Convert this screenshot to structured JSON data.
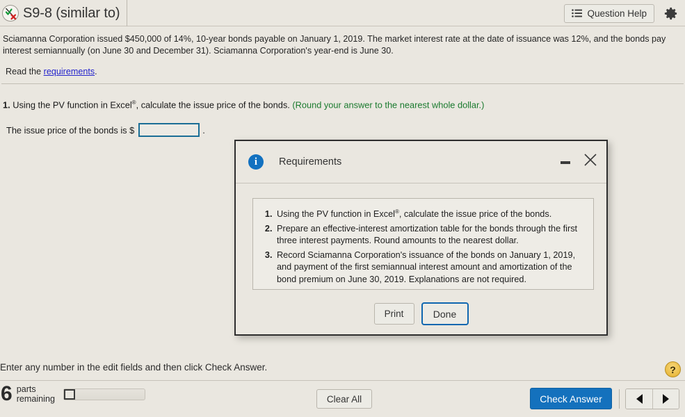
{
  "header": {
    "status_icon": "check-cross-icon",
    "title": "S9-8 (similar to)",
    "question_help_label": "Question Help",
    "question_help_icon": "list-icon",
    "settings_icon": "gear-icon"
  },
  "problem": {
    "statement": "Sciamanna Corporation issued $450,000 of 14%, 10-year bonds payable on January 1, 2019. The market interest rate at the date of issuance was 12%, and the bonds pay interest semiannually (on June 30 and December 31). Sciamanna Corporation's year-end is June 30.",
    "read_prefix": "Read the ",
    "read_link": "requirements",
    "read_suffix": "."
  },
  "question": {
    "number": "1.",
    "text_before_sup": " Using the PV function in Excel",
    "sup": "®",
    "text_after_sup": ", calculate the issue price of the bonds. ",
    "rounding_note": "(Round your answer to the nearest whole dollar.)",
    "answer_label": "The issue price of the bonds is $",
    "answer_value": "",
    "answer_placeholder": "",
    "answer_suffix": ".",
    "answer_border_color": "#1a6e96"
  },
  "dialog": {
    "info_icon": "info-icon",
    "glyph": "i",
    "title": "Requirements",
    "minimize_icon": "minimize-icon",
    "close_icon": "close-icon",
    "requirements": [
      {
        "text_before_sup": "Using the PV function in Excel",
        "sup": "®",
        "text_after_sup": ", calculate the issue price of the bonds."
      },
      {
        "text_before_sup": "Prepare an effective-interest amortization table for the bonds through the first three interest payments. Round amounts to the nearest dollar.",
        "sup": "",
        "text_after_sup": ""
      },
      {
        "text_before_sup": "Record Sciamanna Corporation's issuance of the bonds on January 1, 2019, and payment of the first semiannual interest amount and amortization of the bond premium on June 30, 2019. Explanations are not required.",
        "sup": "",
        "text_after_sup": ""
      }
    ],
    "print_label": "Print",
    "done_label": "Done",
    "done_focus_color": "#1067b0"
  },
  "footer": {
    "enter_message": "Enter any number in the edit fields and then click Check Answer.",
    "help_glyph": "?",
    "parts_count": "6",
    "parts_label_line1": "parts",
    "parts_label_line2": "remaining",
    "clear_all_label": "Clear All",
    "check_answer_label": "Check Answer",
    "check_answer_color": "#1471bd",
    "prev_icon": "triangle-left-icon",
    "next_icon": "triangle-right-icon"
  }
}
